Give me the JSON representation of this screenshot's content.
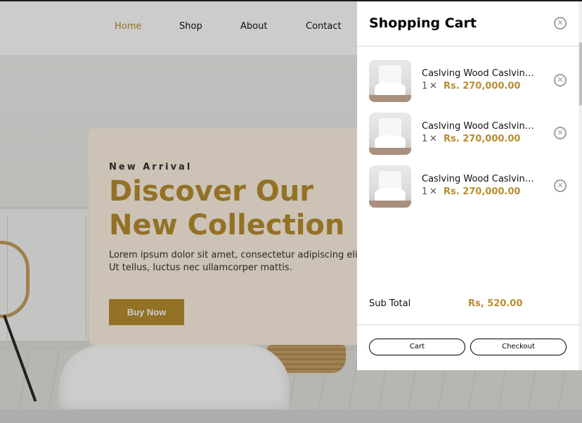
{
  "nav": {
    "items": [
      {
        "label": "Home",
        "active": true
      },
      {
        "label": "Shop",
        "active": false
      },
      {
        "label": "About",
        "active": false
      },
      {
        "label": "Contact",
        "active": false
      }
    ]
  },
  "hero": {
    "eyebrow": "New Arrival",
    "title": "Discover Our New Collection",
    "description": "Lorem ipsum dolor sit amet, consectetur adipiscing elit. Ut tellus, luctus nec ullamcorper mattis.",
    "cta_label": "Buy Now"
  },
  "cart": {
    "title": "Shopping Cart",
    "close_icon": "close-circle-icon",
    "items": [
      {
        "name": "Caslving Wood Caslving Wood",
        "qty": "1",
        "times": "✕",
        "price": "Rs. 270,000.00",
        "remove_icon": "remove-circle-icon"
      },
      {
        "name": "Caslving Wood Caslving Wood",
        "qty": "1",
        "times": "✕",
        "price": "Rs. 270,000.00",
        "remove_icon": "remove-circle-icon"
      },
      {
        "name": "Caslving Wood Caslving Wood",
        "qty": "1",
        "times": "✕",
        "price": "Rs. 270,000.00",
        "remove_icon": "remove-circle-icon"
      }
    ],
    "subtotal_label": "Sub Total",
    "subtotal_value": "Rs, 520.00",
    "cart_button": "Cart",
    "checkout_button": "Checkout"
  },
  "colors": {
    "accent": "#b88e2f",
    "hero_card": "#fff3e3",
    "overlay": "rgba(0,0,0,0.2)"
  }
}
